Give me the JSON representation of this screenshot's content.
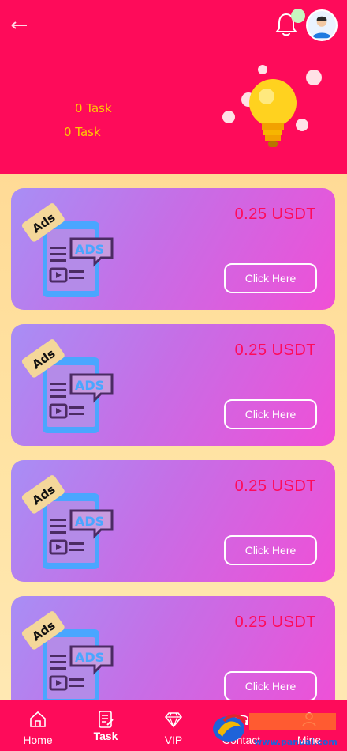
{
  "header": {
    "task_line_1": "0 Task",
    "task_line_2": "0 Task"
  },
  "cards": [
    {
      "price": "0.25 USDT",
      "badge": "Ads",
      "button": "Click Here"
    },
    {
      "price": "0.25 USDT",
      "badge": "Ads",
      "button": "Click Here"
    },
    {
      "price": "0.25 USDT",
      "badge": "Ads",
      "button": "Click Here"
    },
    {
      "price": "0.25 USDT",
      "badge": "Ads",
      "button": "Click Here"
    }
  ],
  "nav": {
    "items": [
      {
        "label": "Home",
        "icon": "home-icon"
      },
      {
        "label": "Task",
        "icon": "task-icon"
      },
      {
        "label": "VIP",
        "icon": "diamond-icon"
      },
      {
        "label": "Contact",
        "icon": "contact-icon"
      },
      {
        "label": "Mine",
        "icon": "user-icon"
      }
    ]
  },
  "watermark": {
    "text": "www.panuai.com"
  },
  "colors": {
    "primary": "#fe0b5a",
    "accent": "#ffcc00",
    "card_gradient_start": "#a88ef5",
    "card_gradient_end": "#f04fd6"
  }
}
